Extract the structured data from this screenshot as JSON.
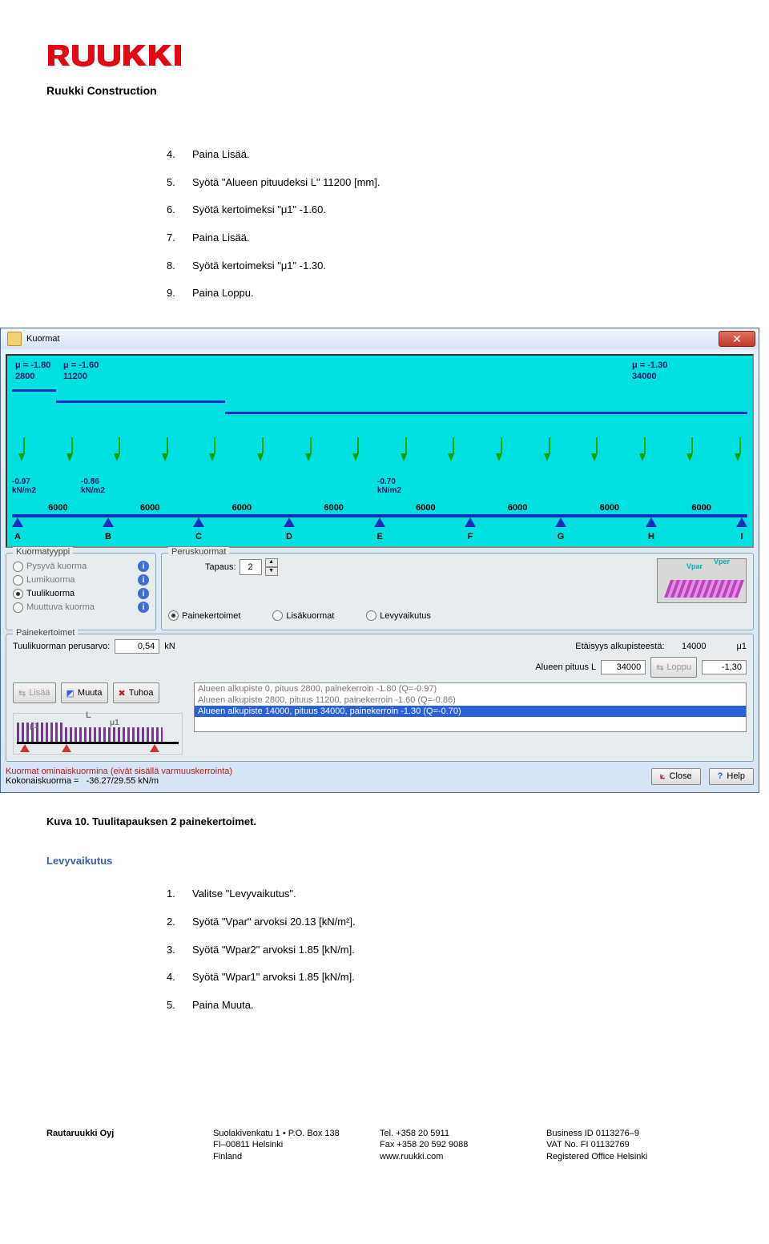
{
  "header": {
    "company": "Ruukki Construction"
  },
  "steps1": [
    {
      "n": "4.",
      "t": "Paina Lisää."
    },
    {
      "n": "5.",
      "t": "Syötä \"Alueen pituudeksi L\" 11200 [mm]."
    },
    {
      "n": "6.",
      "t": "Syötä kertoimeksi \"μ1\" -1.60."
    },
    {
      "n": "7.",
      "t": "Paina Lisää."
    },
    {
      "n": "8.",
      "t": "Syötä kertoimeksi \"μ1\" -1.30."
    },
    {
      "n": "9.",
      "t": "Paina Loppu."
    }
  ],
  "win": {
    "title": "Kuormat",
    "mu": [
      {
        "mu": "μ = -1.80",
        "v": "2800"
      },
      {
        "mu": "μ = -1.60",
        "v": "11200"
      },
      {
        "mu": "μ = -1.30",
        "v": "34000"
      }
    ],
    "q": [
      {
        "v": "-0.97",
        "u": "kN/m2"
      },
      {
        "v": "-0.86",
        "u": "kN/m2"
      },
      {
        "v": "-0.70",
        "u": "kN/m2"
      }
    ],
    "spans": [
      "6000",
      "6000",
      "6000",
      "6000",
      "6000",
      "6000",
      "6000",
      "6000"
    ],
    "letters": [
      "A",
      "B",
      "C",
      "D",
      "E",
      "F",
      "G",
      "H",
      "I"
    ],
    "kuormatyyppi": {
      "legend": "Kuormatyyppi",
      "opts": [
        "Pysyvä kuorma",
        "Lumikuorma",
        "Tuulikuorma",
        "Muuttuva kuorma"
      ],
      "selected": 2
    },
    "perus": {
      "legend": "Peruskuormat",
      "tapaus_label": "Tapaus:",
      "tapaus_value": "2",
      "vpar": "Vpar",
      "vper": "Vper",
      "opts": [
        "Painekertoimet",
        "Lisäkuormat",
        "Levyvaikutus"
      ],
      "selected": 0
    },
    "paine": {
      "legend": "Painekertoimet",
      "tuuli_label": "Tuulikuorman perusarvo:",
      "tuuli_value": "0,54",
      "tuuli_unit": "kN",
      "et_label": "Etäisyys alkupisteestä:",
      "et_value": "14000",
      "mu_label": "μ1",
      "al_label": "Alueen pituus L",
      "al_value": "34000",
      "loppu_btn": "Loppu",
      "mu_value": "-1,30",
      "btns": {
        "lisaa": "Lisää",
        "muuta": "Muuta",
        "tuhoa": "Tuhoa"
      },
      "list": [
        "Alueen alkupiste 0, pituus 2800, painekerroin -1.80  (Q=-0.97)",
        "Alueen alkupiste 2800, pituus 11200, painekerroin -1.60  (Q=-0.86)",
        "Alueen alkupiste 14000, pituus 34000, painekerroin -1.30  (Q=-0.70)"
      ],
      "list_selected": 2,
      "diag": {
        "L": "L",
        "mu1a": "μ1",
        "mu1b": "μ1"
      }
    },
    "foot": {
      "warn": "Kuormat ominaiskuormina (eivät sisällä varmuuskerrointa)",
      "kk_label": "Kokonaiskuorma =",
      "kk_value": "-36.27/29.55   kN/m",
      "close": "Close",
      "help": "Help"
    }
  },
  "caption": "Kuva 10. Tuulitapauksen 2 painekertoimet.",
  "subhead": "Levyvaikutus",
  "steps2": [
    {
      "n": "1.",
      "t": "Valitse \"Levyvaikutus\"."
    },
    {
      "n": "2.",
      "t": "Syötä \"Vpar\" arvoksi 20.13 [kN/m²]."
    },
    {
      "n": "3.",
      "t": "Syötä \"Wpar2\" arvoksi 1.85 [kN/m]."
    },
    {
      "n": "4.",
      "t": "Syötä \"Wpar1\" arvoksi 1.85 [kN/m]."
    },
    {
      "n": "5.",
      "t": "Paina Muuta."
    }
  ],
  "footer": {
    "c1": [
      "Rautaruukki Oyj"
    ],
    "c2": [
      "Suolakivenkatu 1 • P.O. Box 138",
      "FI–00811 Helsinki",
      "Finland"
    ],
    "c3": [
      "Tel. +358 20 5911",
      "Fax +358 20 592 9088",
      "www.ruukki.com"
    ],
    "c4": [
      "Business ID 0113276–9",
      "VAT No. FI 01132769",
      "Registered Office Helsinki"
    ]
  }
}
